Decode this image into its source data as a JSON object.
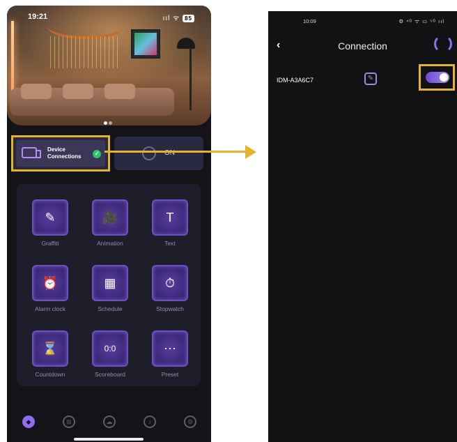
{
  "left_screen": {
    "status_time": "19:21",
    "status_icons": "ııl ᯤ",
    "battery": "85",
    "device_connections_label": "Device Connections",
    "on_label": "ON",
    "tiles": [
      {
        "label": "Graffiti",
        "icon": "graffiti-icon",
        "glyph": "✎"
      },
      {
        "label": "Animation",
        "icon": "animation-icon",
        "glyph": "🎥"
      },
      {
        "label": "Text",
        "icon": "text-icon",
        "glyph": "T"
      },
      {
        "label": "Alarm clock",
        "icon": "alarm-clock-icon",
        "glyph": "⏰"
      },
      {
        "label": "Schedule",
        "icon": "schedule-icon",
        "glyph": "▦"
      },
      {
        "label": "Stopwatch",
        "icon": "stopwatch-icon",
        "glyph": "⏱"
      },
      {
        "label": "Countdown",
        "icon": "hourglass-icon",
        "glyph": "⌛"
      },
      {
        "label": "Scoreboard",
        "icon": "scoreboard-icon",
        "glyph": "0:0"
      },
      {
        "label": "Preset",
        "icon": "preset-icon",
        "glyph": "⋯"
      }
    ],
    "tabbar": [
      {
        "icon": "compass-icon",
        "glyph": "◆",
        "active": true
      },
      {
        "icon": "grid-icon",
        "glyph": "⊞",
        "active": false
      },
      {
        "icon": "cloud-icon",
        "glyph": "☁",
        "active": false
      },
      {
        "icon": "music-icon",
        "glyph": "♪",
        "active": false
      },
      {
        "icon": "settings-icon",
        "glyph": "⚙",
        "active": false
      }
    ]
  },
  "right_screen": {
    "status_time": "10:09",
    "status_icons": "⚙ ⁴ᴳ ᯤ ▭ ⁵ᴳ ııl",
    "title": "Connection",
    "device_id": "IDM-A3A6C7",
    "toggle_on": true
  },
  "colors": {
    "highlight": "#e2b52c",
    "accent": "#8f6cf0",
    "check_green": "#2fc56b"
  }
}
